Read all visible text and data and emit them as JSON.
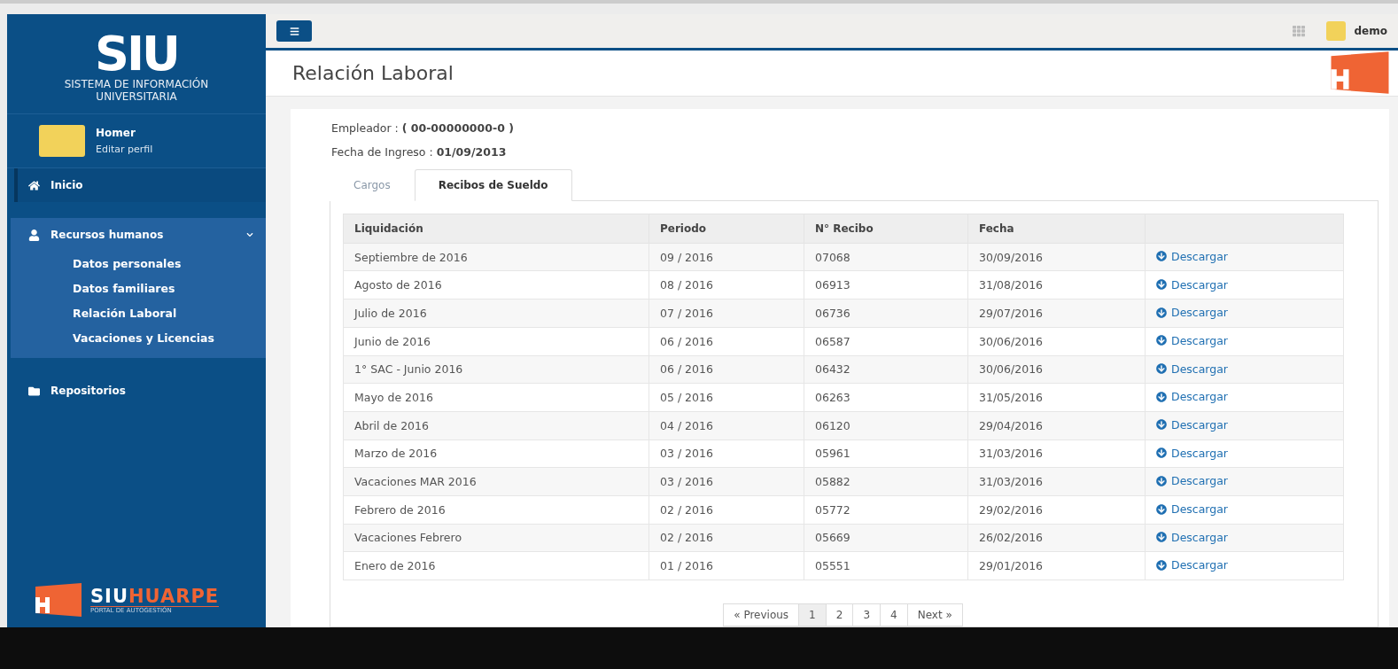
{
  "logo": {
    "mark": "SIU",
    "subtitle": "SISTEMA DE INFORMACIÓN UNIVERSITARIA"
  },
  "user": {
    "name": "Homer",
    "link": "Editar perfil"
  },
  "sidebar": {
    "items": [
      {
        "label": "Inicio",
        "selected": true,
        "expanded": false
      },
      {
        "label": "Recursos humanos",
        "selected": false,
        "expanded": true,
        "children": [
          {
            "label": "Datos personales"
          },
          {
            "label": "Datos familiares"
          },
          {
            "label": "Relación Laboral"
          },
          {
            "label": "Vacaciones y Licencias"
          }
        ]
      },
      {
        "label": "Repositorios",
        "selected": false,
        "expanded": false
      }
    ]
  },
  "brand": {
    "first": "SIU",
    "second": "HUARPE",
    "tagline": "PORTAL DE AUTOGESTIÓN"
  },
  "topbar": {
    "user": "demo"
  },
  "page": {
    "title": "Relación Laboral"
  },
  "info": [
    {
      "label": "Empleador : ",
      "value": "( 00-00000000-0 )"
    },
    {
      "label": "Fecha de Ingreso : ",
      "value": "01/09/2013"
    }
  ],
  "tabs": [
    {
      "label": "Cargos",
      "selected": false
    },
    {
      "label": "Recibos de Sueldo",
      "selected": true
    }
  ],
  "table": {
    "columns": [
      "Liquidación",
      "Periodo",
      "N° Recibo",
      "Fecha"
    ],
    "rows": [
      [
        "Septiembre de 2016",
        "09 / 2016",
        "07068",
        "30/09/2016",
        "Descargar"
      ],
      [
        "Agosto de 2016",
        "08 / 2016",
        "06913",
        "31/08/2016",
        "Descargar"
      ],
      [
        "Julio de 2016",
        "07 / 2016",
        "06736",
        "29/07/2016",
        "Descargar"
      ],
      [
        "Junio de 2016",
        "06 / 2016",
        "06587",
        "30/06/2016",
        "Descargar"
      ],
      [
        "1° SAC - Junio 2016",
        "06 / 2016",
        "06432",
        "30/06/2016",
        "Descargar"
      ],
      [
        "Mayo de 2016",
        "05 / 2016",
        "06263",
        "31/05/2016",
        "Descargar"
      ],
      [
        "Abril de 2016",
        "04 / 2016",
        "06120",
        "29/04/2016",
        "Descargar"
      ],
      [
        "Marzo de 2016",
        "03 / 2016",
        "05961",
        "31/03/2016",
        "Descargar"
      ],
      [
        "Vacaciones MAR 2016",
        "03 / 2016",
        "05882",
        "31/03/2016",
        "Descargar"
      ],
      [
        "Febrero de 2016",
        "02 / 2016",
        "05772",
        "29/02/2016",
        "Descargar"
      ],
      [
        "Vacaciones Febrero",
        "02 / 2016",
        "05669",
        "26/02/2016",
        "Descargar"
      ],
      [
        "Enero de 2016",
        "01 / 2016",
        "05551",
        "29/01/2016",
        "Descargar"
      ]
    ]
  },
  "pagination": [
    {
      "label": "« Previous",
      "selected": false
    },
    {
      "label": "1",
      "selected": true
    },
    {
      "label": "2",
      "selected": false
    },
    {
      "label": "3",
      "selected": false
    },
    {
      "label": "4",
      "selected": false
    },
    {
      "label": "Next »",
      "selected": false
    }
  ]
}
